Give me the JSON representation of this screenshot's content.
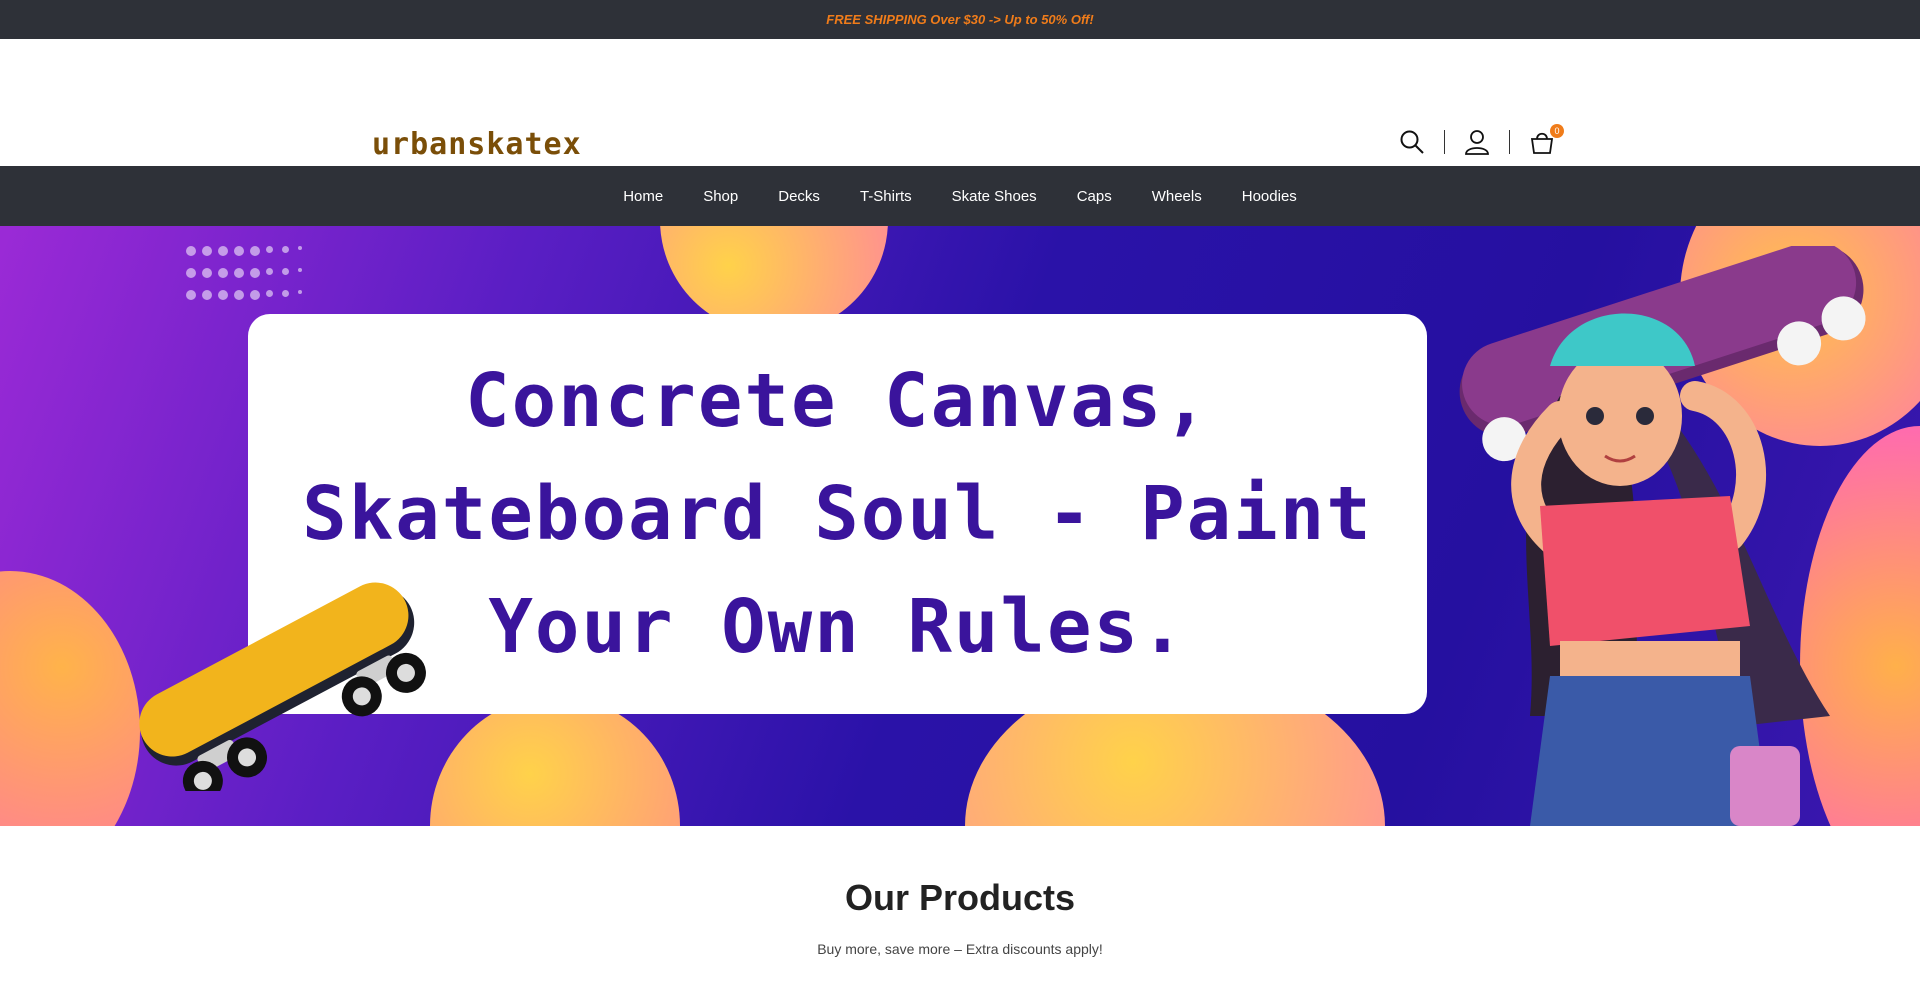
{
  "announcement": {
    "text": "FREE SHIPPING Over $30 -> Up to 50% Off!"
  },
  "header": {
    "logo": "urbanskatex",
    "cart_count": "0",
    "icons": [
      "search-icon",
      "account-icon",
      "cart-icon"
    ]
  },
  "nav": {
    "items": [
      {
        "label": "Home"
      },
      {
        "label": "Shop"
      },
      {
        "label": "Decks"
      },
      {
        "label": "T-Shirts"
      },
      {
        "label": "Skate Shoes"
      },
      {
        "label": "Caps"
      },
      {
        "label": "Wheels"
      },
      {
        "label": "Hoodies"
      }
    ]
  },
  "hero": {
    "headline": "Concrete Canvas, Skateboard Soul - Paint Your Own Rules."
  },
  "products": {
    "title": "Our Products",
    "subtitle": "Buy more, save more – Extra discounts apply!"
  },
  "colors": {
    "accent": "#f07c1a",
    "dark_bar": "#2e3138",
    "logo": "#7a4e08",
    "headline": "#3a149c"
  }
}
